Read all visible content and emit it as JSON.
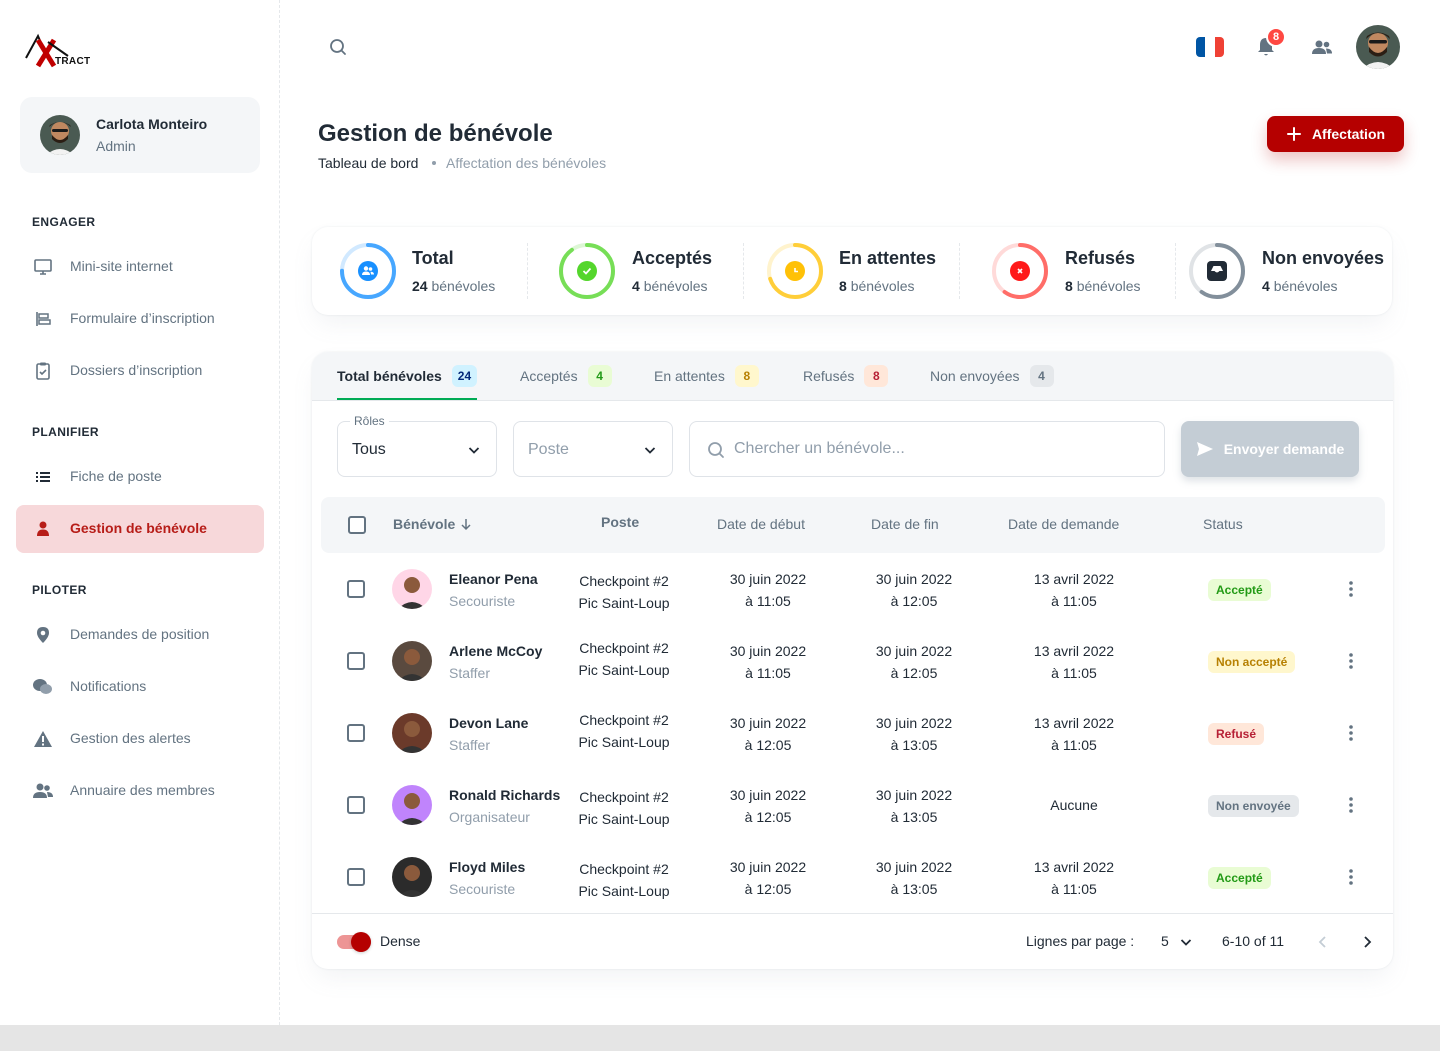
{
  "brand": {
    "logo_text": "TRACT"
  },
  "user": {
    "name": "Carlota Monteiro",
    "role": "Admin"
  },
  "sidebar": {
    "sections": [
      {
        "title": "ENGAGER",
        "items": [
          {
            "label": "Mini-site internet",
            "icon": "monitor-icon"
          },
          {
            "label": "Formulaire d’inscription",
            "icon": "form-icon"
          },
          {
            "label": "Dossiers d’inscription",
            "icon": "clipboard-icon"
          }
        ]
      },
      {
        "title": "PLANIFIER",
        "items": [
          {
            "label": "Fiche de poste",
            "icon": "list-icon"
          },
          {
            "label": "Gestion de bénévole",
            "icon": "user-icon",
            "active": true
          }
        ]
      },
      {
        "title": "PILOTER",
        "items": [
          {
            "label": "Demandes de position",
            "icon": "location-pin-icon"
          },
          {
            "label": "Notifications",
            "icon": "chat-bubbles-icon"
          },
          {
            "label": "Gestion des alertes",
            "icon": "warning-icon"
          },
          {
            "label": "Annuaire des membres",
            "icon": "users-icon"
          }
        ]
      }
    ]
  },
  "topbar": {
    "notification_count": "8",
    "language": "fr"
  },
  "header": {
    "title": "Gestion de bénévole",
    "breadcrumb": [
      "Tableau de bord",
      "Affectation des bénévoles"
    ],
    "action_label": "Affectation"
  },
  "stats": [
    {
      "title": "Total",
      "count": "24",
      "unit": "bénévoles",
      "color": "#1890FF",
      "progress": 0.75,
      "icon": "users-icon"
    },
    {
      "title": "Acceptés",
      "count": "4",
      "unit": "bénévoles",
      "color": "#54D62C",
      "progress": 0.9,
      "icon": "check-circle-icon"
    },
    {
      "title": "En attentes",
      "count": "8",
      "unit": "bénévoles",
      "color": "#FFC107",
      "progress": 0.7,
      "icon": "clock-icon"
    },
    {
      "title": "Refusés",
      "count": "8",
      "unit": "bénévoles",
      "color": "#FF4842",
      "progress": 0.6,
      "icon": "x-circle-icon"
    },
    {
      "title": "Non envoyées",
      "count": "4",
      "unit": "bénévoles",
      "color": "#637381",
      "progress": 0.6,
      "icon": "inbox-icon"
    }
  ],
  "tabs": [
    {
      "label": "Total bénévoles",
      "count": "24",
      "bg": "#D0F2FF",
      "fg": "#04297A",
      "active": true
    },
    {
      "label": "Acceptés",
      "count": "4",
      "bg": "#E9FCD4",
      "fg": "#229A16"
    },
    {
      "label": "En attentes",
      "count": "8",
      "bg": "#FFF7CD",
      "fg": "#B78103"
    },
    {
      "label": "Refusés",
      "count": "8",
      "bg": "#FFE7D9",
      "fg": "#B72136"
    },
    {
      "label": "Non envoyées",
      "count": "4",
      "bg": "#E5E8EB",
      "fg": "#637381"
    }
  ],
  "filters": {
    "roles_label": "Rôles",
    "roles_value": "Tous",
    "poste_placeholder": "Poste",
    "search_placeholder": "Chercher un bénévole...",
    "send_label": "Envoyer demande"
  },
  "table": {
    "headers": [
      "Bénévole",
      "Poste",
      "Date de début",
      "Date de fin",
      "Date de demande",
      "Status"
    ],
    "rows": [
      {
        "name": "Eleanor Pena",
        "role": "Secouriste",
        "poste1": "Checkpoint #2",
        "poste2": "Pic Saint-Loup",
        "start1": "30 juin 2022",
        "start2": "à 11:05",
        "end1": "30 juin 2022",
        "end2": "à 12:05",
        "req1": "13 avril 2022",
        "req2": "à 11:05",
        "status": "Accepté",
        "status_bg": "#E9FCD4",
        "status_fg": "#229A16",
        "avatar_bg": "#FFD6E7"
      },
      {
        "name": "Arlene McCoy",
        "role": "Staffer",
        "poste1": "Checkpoint #2",
        "poste2": "Pic Saint-Loup",
        "start1": "30 juin 2022",
        "start2": "à 11:05",
        "end1": "30 juin 2022",
        "end2": "à 12:05",
        "req1": "13 avril 2022",
        "req2": "à 11:05",
        "status": "Non accepté",
        "status_bg": "#FFF7CD",
        "status_fg": "#B78103",
        "avatar_bg": "#5A4A3F"
      },
      {
        "name": "Devon Lane",
        "role": "Staffer",
        "poste1": "Checkpoint #2",
        "poste2": "Pic Saint-Loup",
        "start1": "30 juin 2022",
        "start2": "à 12:05",
        "end1": "30 juin 2022",
        "end2": "à 13:05",
        "req1": "13 avril 2022",
        "req2": "à 11:05",
        "status": "Refusé",
        "status_bg": "#FFE7D9",
        "status_fg": "#B72136",
        "avatar_bg": "#6B3A2A"
      },
      {
        "name": "Ronald Richards",
        "role": "Organisateur",
        "poste1": "Checkpoint #2",
        "poste2": "Pic Saint-Loup",
        "start1": "30 juin 2022",
        "start2": "à 12:05",
        "end1": "30 juin 2022",
        "end2": "à 13:05",
        "req1": "Aucune",
        "req2": "",
        "status": "Non envoyée",
        "status_bg": "#E5E8EB",
        "status_fg": "#637381",
        "avatar_bg": "#C084FC"
      },
      {
        "name": "Floyd Miles",
        "role": "Secouriste",
        "poste1": "Checkpoint #2",
        "poste2": "Pic Saint-Loup",
        "start1": "30 juin 2022",
        "start2": "à 12:05",
        "end1": "30 juin 2022",
        "end2": "à 13:05",
        "req1": "13 avril 2022",
        "req2": "à 11:05",
        "status": "Accepté",
        "status_bg": "#E9FCD4",
        "status_fg": "#229A16",
        "avatar_bg": "#2B2B2B"
      }
    ]
  },
  "footer": {
    "dense_label": "Dense",
    "rows_per_page_label": "Lignes par page :",
    "rows_per_page": "5",
    "range": "6-10 of 11"
  },
  "colors": {
    "primary": "#B50000",
    "active_bg": "#F7D8DA",
    "active_fg": "#B71D18"
  }
}
